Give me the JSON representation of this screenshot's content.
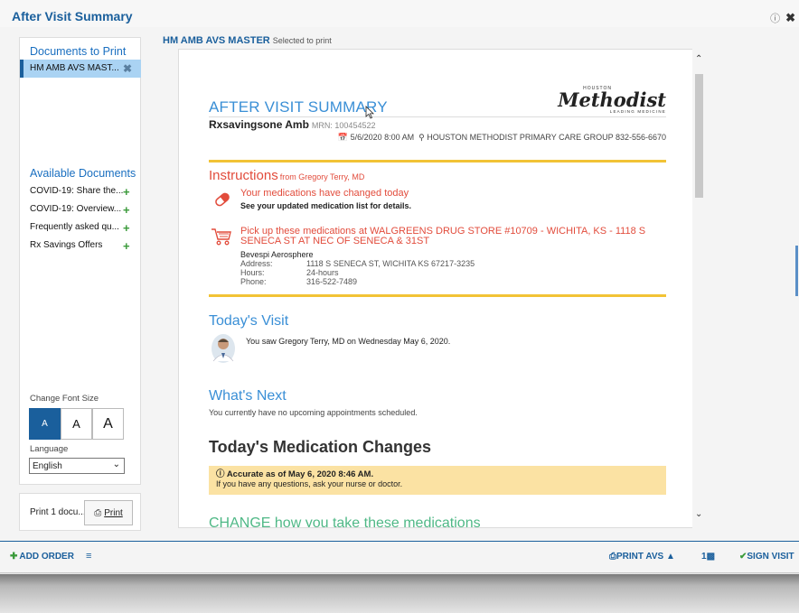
{
  "window": {
    "title": "After Visit Summary",
    "help_icon": "help-icon",
    "close_icon": "close-icon"
  },
  "sidebar": {
    "docs_to_print_header": "Documents to Print",
    "selected_doc": "HM AMB AVS MAST...",
    "available_header": "Available Documents",
    "available": [
      {
        "label": "COVID-19: Share the..."
      },
      {
        "label": "COVID-19: Overview..."
      },
      {
        "label": "Frequently asked qu..."
      },
      {
        "label": "Rx Savings Offers"
      }
    ],
    "font_size_label": "Change Font Size",
    "font_sizes": [
      "A",
      "A",
      "A"
    ],
    "language_label": "Language",
    "language_value": "English",
    "print_count": "Print 1 docu...",
    "print_label": "Print"
  },
  "document": {
    "header_name": "HM AMB AVS MASTER",
    "header_sub": "Selected to print",
    "avs_title": "AFTER VISIT SUMMARY",
    "logo": {
      "houston": "HOUSTON",
      "methodist": "Methodist",
      "leading": "LEADING MEDICINE"
    },
    "patient_name": "Rxsavingsone Amb",
    "mrn": "MRN: 100454522",
    "visit_line": "5/6/2020 8:00 AM",
    "visit_location": "HOUSTON METHODIST PRIMARY CARE GROUP 832-556-6670",
    "instructions_head": "Instructions",
    "instructions_from": "from Gregory Terry, MD",
    "med_changed": "Your medications have changed today",
    "med_note": "See your updated medication list for details.",
    "pickup": "Pick up these medications at WALGREENS DRUG STORE #10709 - WICHITA, KS - 1118 S SENECA ST AT NEC OF SENECA & 31ST",
    "drug_name": "Bevespi Aerosphere",
    "pharmacy": [
      {
        "k": "Address:",
        "v": "1118 S SENECA ST, WICHITA KS 67217-3235"
      },
      {
        "k": "Hours:",
        "v": "24-hours"
      },
      {
        "k": "Phone:",
        "v": "316-522-7489"
      }
    ],
    "todays_visit_head": "Today's Visit",
    "todays_visit_text": "You saw Gregory Terry, MD on Wednesday May 6, 2020.",
    "whats_next_head": "What's Next",
    "whats_next_text": "You currently have no upcoming appointments scheduled.",
    "med_changes_head": "Today's Medication Changes",
    "accurate_title": "Accurate as of May 6, 2020  8:46 AM.",
    "accurate_text": "If you have any questions, ask your nurse or doctor.",
    "change_head": "CHANGE how you take these medications"
  },
  "footer": {
    "add_order": "ADD ORDER",
    "print_avs": "PRINT AVS",
    "count": "1",
    "sign_visit": "SIGN VISIT"
  },
  "colors": {
    "brand_blue": "#1a5f9c",
    "link_blue": "#3a8fd6",
    "alert_red": "#e24c3c",
    "gold": "#f2c335",
    "plus_green": "#3a9a3a"
  }
}
